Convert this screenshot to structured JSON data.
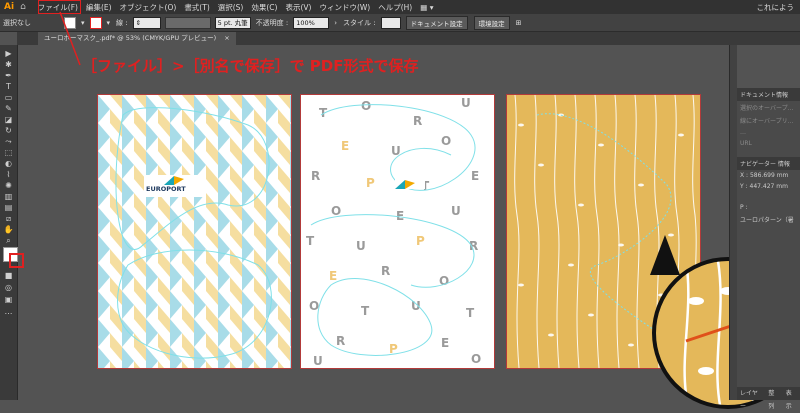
{
  "menubar": {
    "app_logo": "Ai",
    "home_icon": "home-icon",
    "items": [
      "ファイル(F)",
      "編集(E)",
      "オブジェクト(O)",
      "書式(T)",
      "選択(S)",
      "効果(C)",
      "表示(V)",
      "ウィンドウ(W)",
      "ヘルプ(H)"
    ],
    "right_text": "これによう"
  },
  "control_bar": {
    "selection_label": "選択なし",
    "stroke_label": "線 :",
    "brush_value": "5 pt. 丸筆",
    "opacity_label": "不透明度 :",
    "opacity_value": "100%",
    "style_label": "スタイル :",
    "document_setup": "ドキュメント設定",
    "preferences": "環境設定"
  },
  "tab": {
    "title": "ユーロボーマスク_.pdf* @ 53% (CMYK/GPU プレビュー)",
    "close": "×"
  },
  "annotation": {
    "text": "［ファイル］>［別名で保存］で PDF形式で保存"
  },
  "artboard2_letters": [
    "U",
    "R",
    "O",
    "T",
    "P",
    "E"
  ],
  "logo_text": "EUROPORT",
  "panel": {
    "header": "ドキュメント情報",
    "rows": [
      "選択のオーバープ…",
      "線にオーバープリ…",
      "…",
      "URL"
    ],
    "nav_header": "ナビゲーター  情報",
    "x_label": "X :",
    "x_value": "586.699 mm",
    "y_label": "Y :",
    "y_value": "447.427 mm",
    "p_label": "P :",
    "pattern_label": "ユーロパターン（暑",
    "bottom_tabs": [
      "レイヤー",
      "整列",
      "表示"
    ]
  },
  "colors": {
    "accent_red": "#e02020",
    "artboard_yellow": "#e4b85a",
    "pattern_blue": "#a8dce8",
    "pattern_yellow": "#f5dea0",
    "guide_cyan": "#7fe0e8"
  }
}
